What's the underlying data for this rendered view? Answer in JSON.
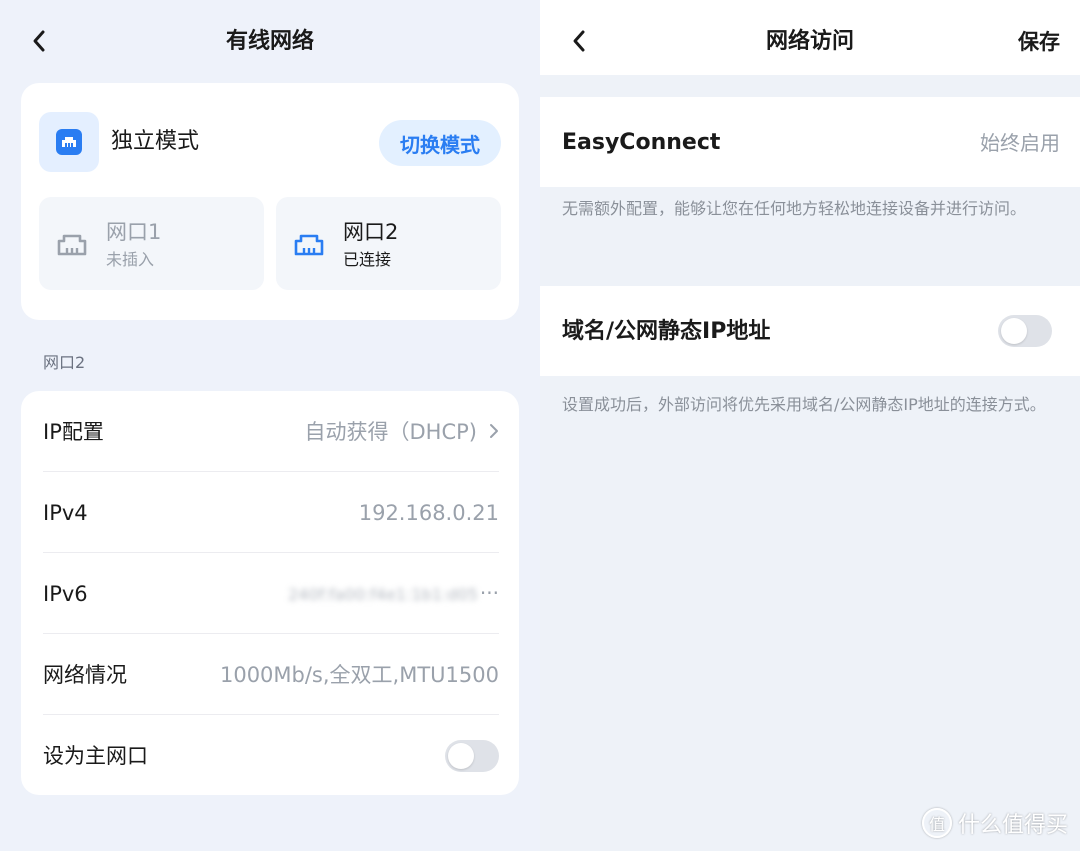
{
  "left": {
    "title": "有线网络",
    "mode": {
      "label": "独立模式",
      "switch_button": "切换模式"
    },
    "ports": [
      {
        "name": "网口1",
        "status": "未插入"
      },
      {
        "name": "网口2",
        "status": "已连接"
      }
    ],
    "section_title": "网口2",
    "rows": [
      {
        "label": "IP配置",
        "value": "自动获得（DHCP)"
      },
      {
        "label": "IPv4",
        "value": "192.168.0.21"
      },
      {
        "label": "IPv6",
        "value": "240f:fa00:f4e1:1b1:d05",
        "suffix": "···"
      },
      {
        "label": "网络情况",
        "value": "1000Mb/s,全双工,MTU1500"
      },
      {
        "label": "设为主网口",
        "toggle_on": false
      }
    ]
  },
  "right": {
    "title": "网络访问",
    "save": "保存",
    "easyconnect": {
      "label": "EasyConnect",
      "value": "始终启用"
    },
    "easyconnect_desc": "无需额外配置，能够让您在任何地方轻松地连接设备并进行访问。",
    "static_ip": {
      "label": "域名/公网静态IP地址",
      "toggle_on": false
    },
    "static_ip_desc": "设置成功后，外部访问将优先采用域名/公网静态IP地址的连接方式。"
  },
  "watermark": {
    "text": "什么值得买",
    "logo": "值"
  },
  "colors": {
    "accent": "#2a7df2",
    "accent_bg": "#e3f0ff",
    "background": "#eef2fa",
    "muted_text": "#9aa1ab"
  },
  "icons": {
    "back": "chevron-left-icon",
    "mode": "ethernet-port-icon",
    "port": "ethernet-port-icon",
    "row_more": "chevron-right-icon"
  }
}
